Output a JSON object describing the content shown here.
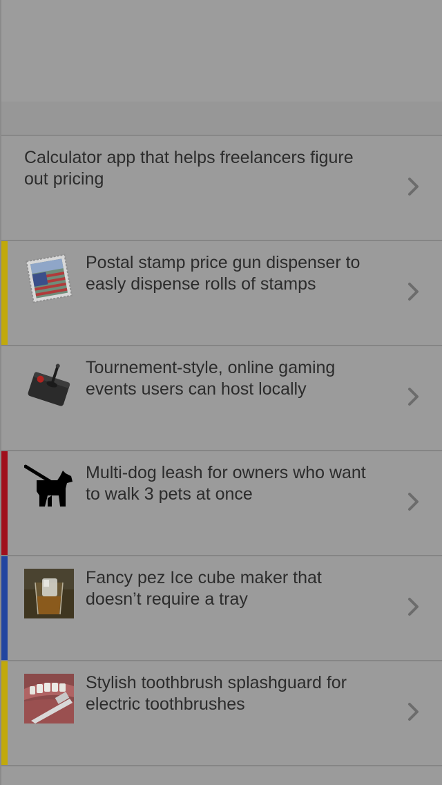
{
  "colors": {
    "accent_yellow": "#c1a90b",
    "accent_red": "#a0101c",
    "accent_blue": "#2245a0",
    "overlay_gray": "#9b9b9b"
  },
  "list": {
    "items": [
      {
        "label": "Calculator app that helps freelancers figure out pricing",
        "accent": "none",
        "icon": "none"
      },
      {
        "label": "Postal stamp price gun dispenser to easly dispense rolls of stamps",
        "accent": "yellow",
        "icon": "stamp-icon"
      },
      {
        "label": "Tournement-style, online gaming events users can host locally",
        "accent": "none",
        "icon": "joystick-icon"
      },
      {
        "label": "Multi-dog leash for owners who want to walk 3 pets at once",
        "accent": "red",
        "icon": "dog-walking-icon"
      },
      {
        "label": "Fancy pez Ice cube maker that doesn’t require a tray",
        "accent": "blue",
        "icon": "ice-cube-glass-image"
      },
      {
        "label": "Stylish toothbrush splashguard for electric toothbrushes",
        "accent": "yellow",
        "icon": "toothbrush-image"
      }
    ]
  }
}
